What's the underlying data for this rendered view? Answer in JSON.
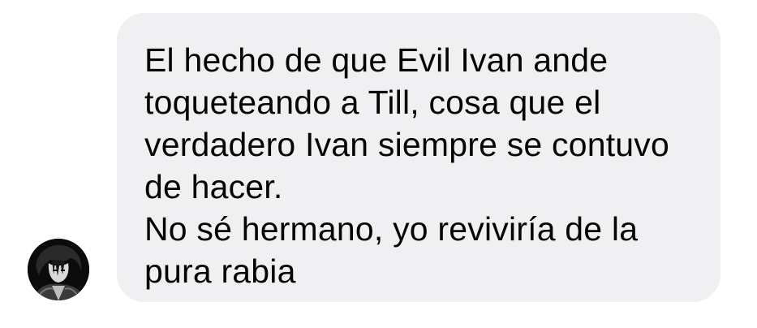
{
  "message": {
    "text": "El hecho de que Evil Ivan ande\ntoqueteando a Till, cosa que el\nverdadero Ivan siempre se contuvo\nde hacer.\nNo sé hermano, yo reviviría de la\npura rabia"
  },
  "avatar": {
    "icon": "profile-avatar-icon"
  },
  "colors": {
    "bubble_background": "#f0f0f3",
    "text": "#050505",
    "page_background": "#ffffff"
  }
}
